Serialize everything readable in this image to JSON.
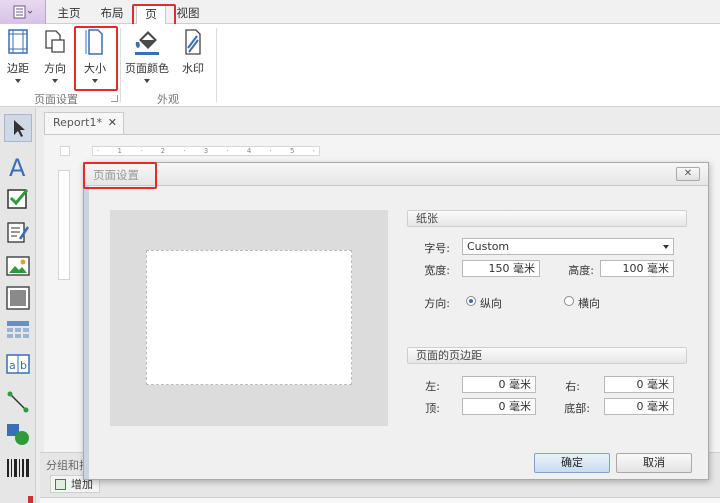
{
  "ribbon_tabs": [
    {
      "label": "主页"
    },
    {
      "label": "布局"
    },
    {
      "label": "页"
    },
    {
      "label": "视图"
    }
  ],
  "active_tab": "页",
  "ribbon": {
    "page_setup_group": {
      "label": "页面设置",
      "buttons": [
        {
          "label": "边距",
          "icon": "margins-icon"
        },
        {
          "label": "方向",
          "icon": "orientation-icon"
        },
        {
          "label": "大小",
          "icon": "page-size-icon"
        }
      ]
    },
    "appearance_group": {
      "label": "外观",
      "buttons": [
        {
          "label": "页面颜色",
          "icon": "paint-bucket-icon"
        },
        {
          "label": "水印",
          "icon": "watermark-icon"
        }
      ]
    }
  },
  "toolbox": [
    "pointer-icon",
    "text-label-icon",
    "checkbox-icon",
    "rich-text-icon",
    "picture-icon",
    "panel-icon",
    "table-icon",
    "character-comb-icon",
    "line-icon",
    "shape-icon",
    "barcode-icon"
  ],
  "document": {
    "tab_title": "Report1*",
    "close_glyph": "✕",
    "ruler_marks": "· 1 · 2 · 3 · 4 · 5 ·"
  },
  "bottom_panel": {
    "title": "分组和排",
    "add_button": "增加"
  },
  "dialog": {
    "title": "页面设置",
    "close_glyph": "✕",
    "paper_section": "纸张",
    "size_label": "字号:",
    "size_value": "Custom",
    "width_label": "宽度:",
    "width_value": "150 毫米",
    "height_label": "高度:",
    "height_value": "100 毫米",
    "orientation_label": "方向:",
    "portrait_label": "纵向",
    "landscape_label": "横向",
    "orientation_selected": "portrait",
    "margins_section": "页面的页边距",
    "left_label": "左:",
    "left_value": "0 毫米",
    "right_label": "右:",
    "right_value": "0 毫米",
    "top_label": "顶:",
    "top_value": "0 毫米",
    "bottom_label": "底部:",
    "bottom_value": "0 毫米",
    "ok_label": "确定",
    "cancel_label": "取消"
  },
  "colors": {
    "highlight_red": "#e12c2c",
    "ok_blue": "#c8dcf1"
  }
}
